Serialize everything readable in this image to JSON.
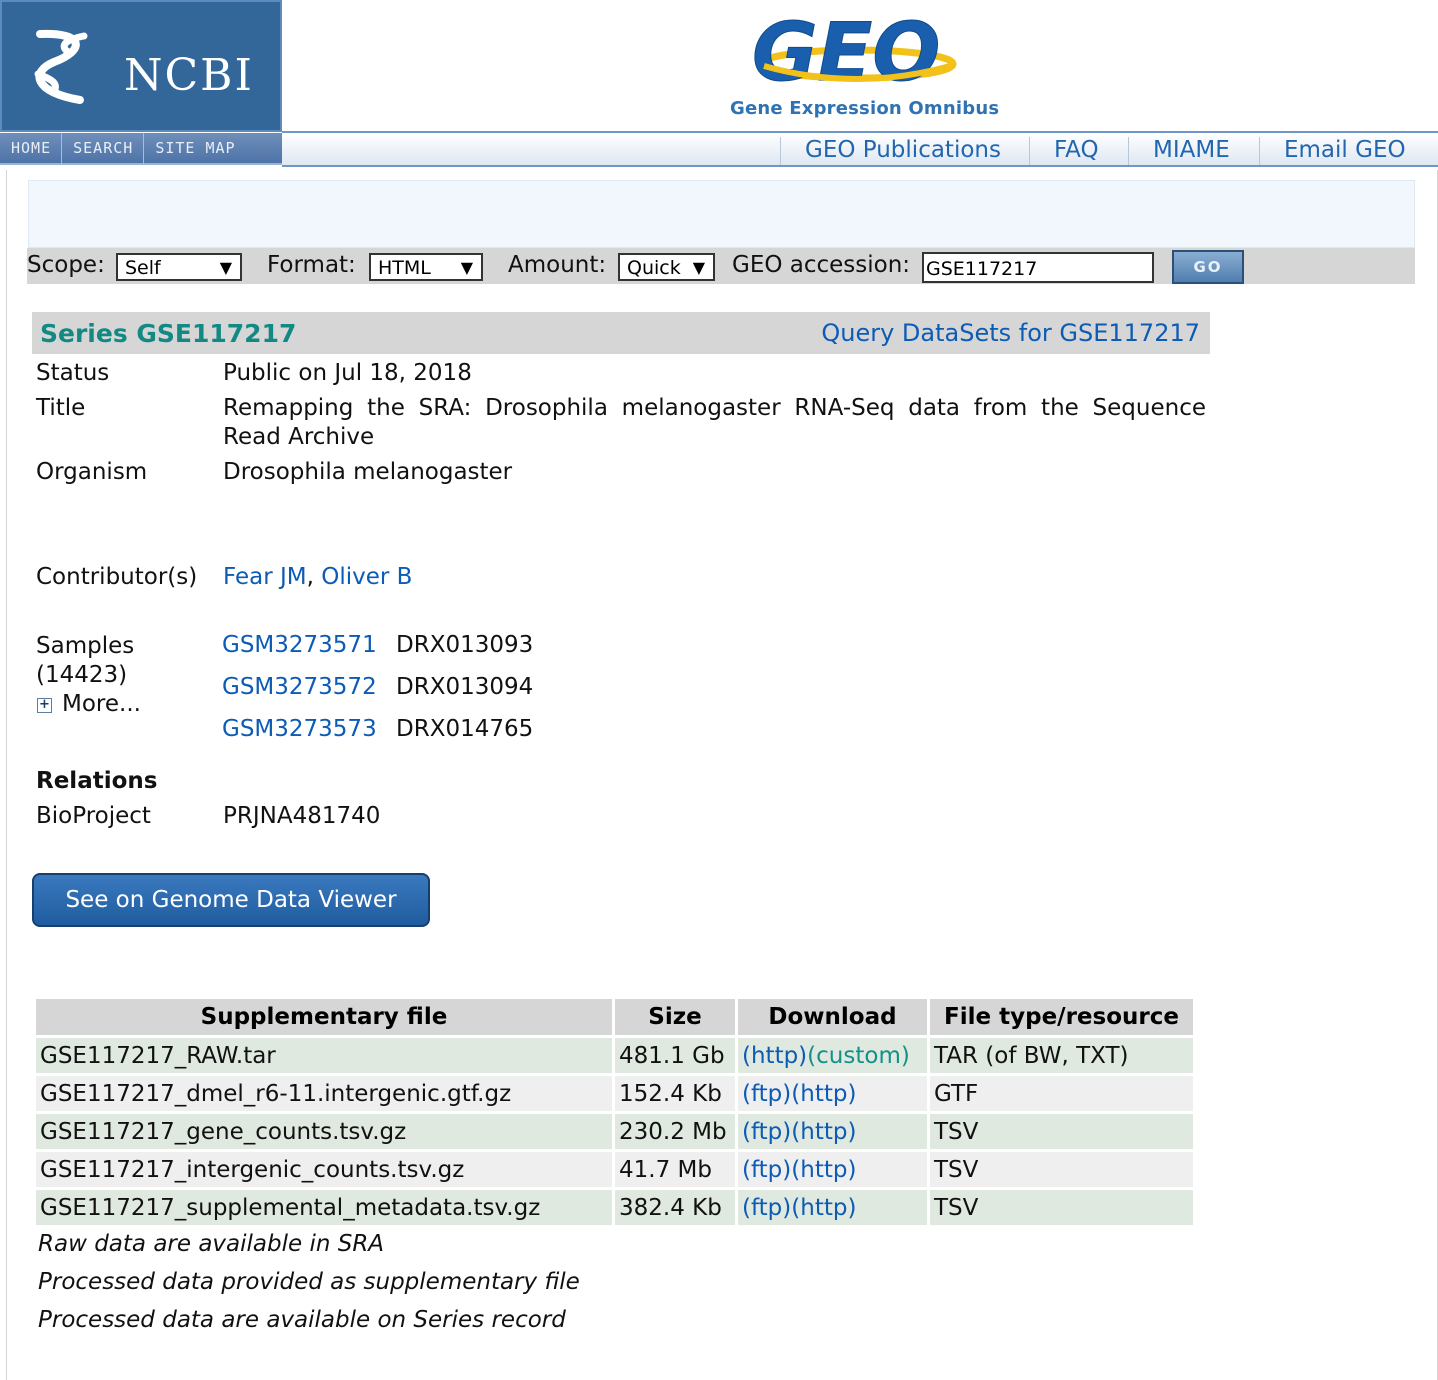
{
  "header": {
    "ncbi_label": "NCBI",
    "ncbi_nav": [
      "HOME",
      "SEARCH",
      "SITE MAP"
    ],
    "geo_logo_text": "GEO",
    "geo_subtitle": "Gene Expression Omnibus",
    "geo_nav": [
      "GEO Publications",
      "FAQ",
      "MIAME",
      "Email GEO"
    ]
  },
  "query": {
    "scope_label": "Scope:",
    "scope_value": "Self",
    "format_label": "Format:",
    "format_value": "HTML",
    "amount_label": "Amount:",
    "amount_value": "Quick",
    "accession_label": "GEO accession:",
    "accession_value": "GSE117217",
    "go_label": "GO"
  },
  "series": {
    "title": "Series GSE117217",
    "query_link": "Query DataSets for GSE117217",
    "status_label": "Status",
    "status_value": "Public on Jul 18, 2018",
    "title_label": "Title",
    "title_value": "Remapping the SRA: Drosophila melanogaster RNA-Seq data from the Sequence Read Archive",
    "organism_label": "Organism",
    "organism_value": "Drosophila melanogaster",
    "contributors_label": "Contributor(s)",
    "contributors": [
      "Fear JM",
      "Oliver B"
    ],
    "contributors_sep": ",",
    "samples_label": "Samples",
    "samples_count": "(14423)",
    "samples_more": "More...",
    "samples": [
      {
        "id": "GSM3273571",
        "acc": "DRX013093"
      },
      {
        "id": "GSM3273572",
        "acc": "DRX013094"
      },
      {
        "id": "GSM3273573",
        "acc": "DRX014765"
      }
    ],
    "relations_label": "Relations",
    "bioproject_label": "BioProject",
    "bioproject_value": "PRJNA481740",
    "gdv_button": "See on Genome Data Viewer"
  },
  "supplementary": {
    "headers": [
      "Supplementary file",
      "Size",
      "Download",
      "File type/resource"
    ],
    "rows": [
      {
        "file": "GSE117217_RAW.tar",
        "size": "481.1 Gb",
        "dl1": "(http)",
        "dl2": "(custom)",
        "type": "TAR (of BW, TXT)"
      },
      {
        "file": "GSE117217_dmel_r6-11.intergenic.gtf.gz",
        "size": "152.4 Kb",
        "dl1": "(ftp)",
        "dl2": "(http)",
        "type": "GTF"
      },
      {
        "file": "GSE117217_gene_counts.tsv.gz",
        "size": "230.2 Mb",
        "dl1": "(ftp)",
        "dl2": "(http)",
        "type": "TSV"
      },
      {
        "file": "GSE117217_intergenic_counts.tsv.gz",
        "size": "41.7 Mb",
        "dl1": "(ftp)",
        "dl2": "(http)",
        "type": "TSV"
      },
      {
        "file": "GSE117217_supplemental_metadata.tsv.gz",
        "size": "382.4 Kb",
        "dl1": "(ftp)",
        "dl2": "(http)",
        "type": "TSV"
      }
    ],
    "notes": [
      "Raw data are available in SRA",
      "Processed data provided as supplementary file",
      "Processed data are available on Series record"
    ]
  }
}
